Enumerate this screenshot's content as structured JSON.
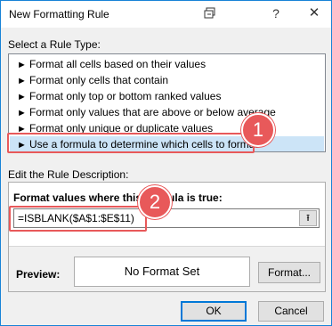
{
  "window": {
    "title": "New Formatting Rule",
    "help_label": "?",
    "close_label": "✕"
  },
  "rule_type": {
    "label": "Select a Rule Type:",
    "items": [
      "Format all cells based on their values",
      "Format only cells that contain",
      "Format only top or bottom ranked values",
      "Format only values that are above or below average",
      "Format only unique or duplicate values",
      "Use a formula to determine which cells to format"
    ],
    "selected_index": 5,
    "arrow_glyph": "─►"
  },
  "description": {
    "label": "Edit the Rule Description:",
    "formula_heading": "Format values where this formula is true:",
    "formula_value": "=ISBLANK($A$1:$E$11)",
    "collapse_glyph": "⭱",
    "preview_label": "Preview:",
    "preview_text": "No Format Set",
    "format_button": "Format..."
  },
  "buttons": {
    "ok": "OK",
    "cancel": "Cancel"
  },
  "annotations": {
    "badge_1": "1",
    "badge_2": "2",
    "color": "#e8595a"
  },
  "colors": {
    "selected_row": "#cce4f7",
    "accent": "#0078d7"
  }
}
